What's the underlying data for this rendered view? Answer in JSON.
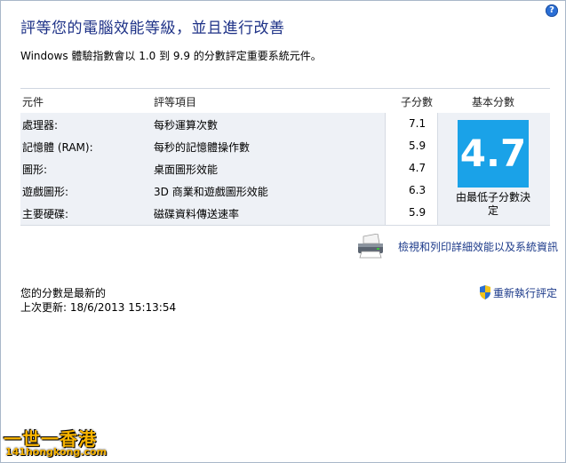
{
  "header": {
    "title": "評等您的電腦效能等級，並且進行改善",
    "subtitle": "Windows 體驗指數會以 1.0 到 9.9 的分數評定重要系統元件。",
    "help_icon": "help-icon"
  },
  "table": {
    "columns": {
      "component": "元件",
      "rated": "評等項目",
      "subscore": "子分數",
      "base": "基本分數"
    },
    "rows": [
      {
        "component": "處理器:",
        "rated": "每秒運算次數",
        "subscore": "7.1"
      },
      {
        "component": "記憶體 (RAM):",
        "rated": "每秒的記憶體操作數",
        "subscore": "5.9"
      },
      {
        "component": "圖形:",
        "rated": "桌面圖形效能",
        "subscore": "4.7"
      },
      {
        "component": "遊戲圖形:",
        "rated": "3D 商業和遊戲圖形效能",
        "subscore": "6.3"
      },
      {
        "component": "主要硬碟:",
        "rated": "磁碟資料傳送速率",
        "subscore": "5.9"
      }
    ],
    "base_score": "4.7",
    "base_caption_line1": "由最低子分數決",
    "base_caption_line2": "定",
    "base_score_color": "#1aa2e8"
  },
  "links": {
    "details": "檢視和列印詳細效能以及系統資訊",
    "details_icon": "printer-icon",
    "rerun": "重新執行評定",
    "rerun_icon": "shield-icon"
  },
  "status": {
    "line1": "您的分數是最新的",
    "line2": "上次更新: 18/6/2013 15:13:54"
  },
  "watermark": {
    "line1": "一世一香港",
    "line2": "141hongkong.com"
  }
}
